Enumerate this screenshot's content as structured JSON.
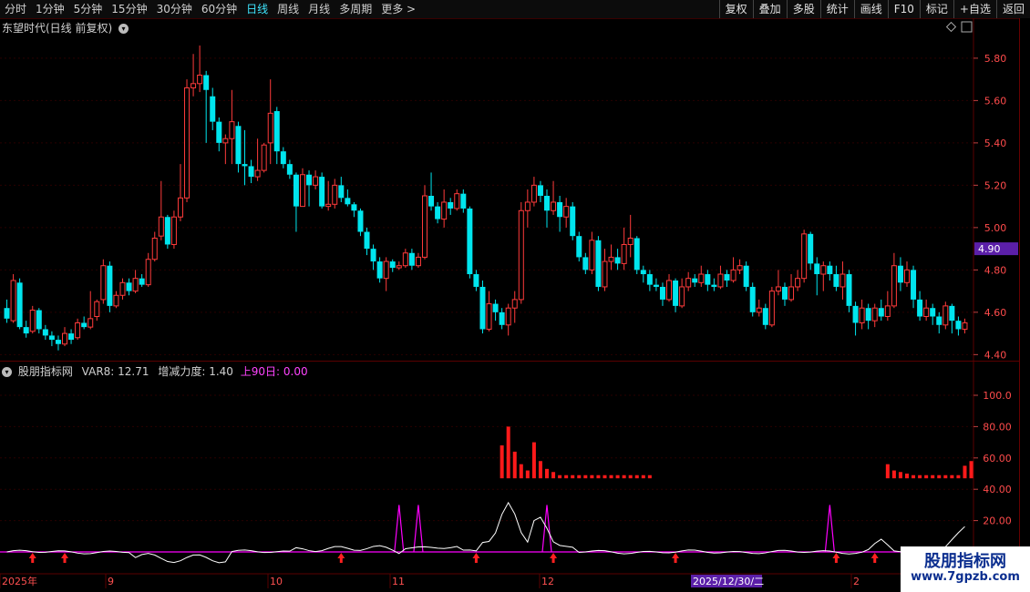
{
  "toolbar": {
    "periods": [
      "分时",
      "1分钟",
      "5分钟",
      "15分钟",
      "30分钟",
      "60分钟",
      "日线",
      "周线",
      "月线",
      "多周期",
      "更多 >"
    ],
    "active": "日线",
    "right_buttons": [
      "复权",
      "叠加",
      "多股",
      "统计",
      "画线",
      "F10",
      "标记",
      "+自选",
      "返回"
    ]
  },
  "stock": {
    "title": "东望时代(日线 前复权)",
    "current_price_tag": "4.90"
  },
  "price_axis": {
    "ticks": [
      "5.80",
      "5.60",
      "5.40",
      "5.20",
      "5.00",
      "4.80",
      "4.60",
      "4.40"
    ],
    "values": [
      5.8,
      5.6,
      5.4,
      5.2,
      5.0,
      4.8,
      4.6,
      4.4
    ]
  },
  "indicator": {
    "name": "股朋指标网",
    "var8": "VAR8: 12.71",
    "force": "增减力度: 1.40",
    "up90": "上90日: 0.00",
    "axis_ticks": [
      "100.0",
      "80.00",
      "60.00",
      "40.00",
      "20.00"
    ],
    "axis_values": [
      100,
      80,
      60,
      40,
      20
    ]
  },
  "time_axis": {
    "labels": [
      "2025年",
      "9",
      "10",
      "11",
      "12",
      "2",
      "2025/12/30/二"
    ]
  },
  "colors": {
    "up": "#ff3b3b",
    "down": "#00e5ee",
    "bg": "#000000",
    "grid": "#2a0000",
    "magenta": "#ff00ff",
    "tag_bg": "#5b1fa8"
  },
  "chart_data": {
    "type": "candlestick",
    "ylim": [
      4.38,
      5.92
    ],
    "candles": [
      [
        4.62,
        4.57,
        4.66,
        4.55
      ],
      [
        4.56,
        4.75,
        4.78,
        4.55
      ],
      [
        4.74,
        4.53,
        4.76,
        4.52
      ],
      [
        4.53,
        4.5,
        4.56,
        4.48
      ],
      [
        4.51,
        4.61,
        4.63,
        4.5
      ],
      [
        4.61,
        4.52,
        4.62,
        4.5
      ],
      [
        4.52,
        4.49,
        4.54,
        4.47
      ],
      [
        4.49,
        4.47,
        4.51,
        4.44
      ],
      [
        4.47,
        4.45,
        4.49,
        4.42
      ],
      [
        4.45,
        4.5,
        4.53,
        4.44
      ],
      [
        4.5,
        4.47,
        4.52,
        4.45
      ],
      [
        4.48,
        4.55,
        4.57,
        4.47
      ],
      [
        4.55,
        4.53,
        4.58,
        4.52
      ],
      [
        4.53,
        4.57,
        4.7,
        4.52
      ],
      [
        4.58,
        4.65,
        4.66,
        4.56
      ],
      [
        4.66,
        4.82,
        4.85,
        4.64
      ],
      [
        4.82,
        4.63,
        4.84,
        4.6
      ],
      [
        4.63,
        4.68,
        4.7,
        4.62
      ],
      [
        4.68,
        4.74,
        4.76,
        4.66
      ],
      [
        4.74,
        4.7,
        4.76,
        4.68
      ],
      [
        4.7,
        4.76,
        4.8,
        4.69
      ],
      [
        4.76,
        4.73,
        4.78,
        4.72
      ],
      [
        4.73,
        4.85,
        4.88,
        4.72
      ],
      [
        4.85,
        4.95,
        4.98,
        4.84
      ],
      [
        4.96,
        5.05,
        5.22,
        4.94
      ],
      [
        5.05,
        4.92,
        5.06,
        4.9
      ],
      [
        4.92,
        5.05,
        5.08,
        4.9
      ],
      [
        5.05,
        5.14,
        5.3,
        5.03
      ],
      [
        5.14,
        5.66,
        5.7,
        5.12
      ],
      [
        5.66,
        5.68,
        5.82,
        5.62
      ],
      [
        5.68,
        5.72,
        5.86,
        5.64
      ],
      [
        5.72,
        5.65,
        5.74,
        5.4
      ],
      [
        5.62,
        5.5,
        5.66,
        5.46
      ],
      [
        5.5,
        5.4,
        5.52,
        5.36
      ],
      [
        5.4,
        5.42,
        5.44,
        5.3
      ],
      [
        5.42,
        5.5,
        5.65,
        5.3
      ],
      [
        5.48,
        5.3,
        5.5,
        5.26
      ],
      [
        5.3,
        5.29,
        5.46,
        5.2
      ],
      [
        5.29,
        5.24,
        5.32,
        5.21
      ],
      [
        5.24,
        5.27,
        5.42,
        5.22
      ],
      [
        5.27,
        5.39,
        5.4,
        5.26
      ],
      [
        5.4,
        5.54,
        5.7,
        5.3
      ],
      [
        5.55,
        5.36,
        5.57,
        5.3
      ],
      [
        5.36,
        5.3,
        5.38,
        5.28
      ],
      [
        5.3,
        5.25,
        5.32,
        5.23
      ],
      [
        5.25,
        5.1,
        5.26,
        4.98
      ],
      [
        5.1,
        5.25,
        5.28,
        5.1
      ],
      [
        5.25,
        5.2,
        5.27,
        5.1
      ],
      [
        5.2,
        5.24,
        5.27,
        5.18
      ],
      [
        5.24,
        5.1,
        5.26,
        5.09
      ],
      [
        5.1,
        5.11,
        5.22,
        5.08
      ],
      [
        5.11,
        5.2,
        5.23,
        5.09
      ],
      [
        5.2,
        5.14,
        5.24,
        5.12
      ],
      [
        5.14,
        5.11,
        5.18,
        5.1
      ],
      [
        5.11,
        5.08,
        5.12,
        5.05
      ],
      [
        5.08,
        4.98,
        5.09,
        4.96
      ],
      [
        4.98,
        4.9,
        5.0,
        4.87
      ],
      [
        4.9,
        4.84,
        4.92,
        4.8
      ],
      [
        4.84,
        4.76,
        4.86,
        4.74
      ],
      [
        4.76,
        4.84,
        4.86,
        4.7
      ],
      [
        4.84,
        4.81,
        4.85,
        4.79
      ],
      [
        4.81,
        4.82,
        4.84,
        4.8
      ],
      [
        4.82,
        4.88,
        4.9,
        4.81
      ],
      [
        4.88,
        4.82,
        4.9,
        4.8
      ],
      [
        4.82,
        4.86,
        4.88,
        4.81
      ],
      [
        4.86,
        5.15,
        5.2,
        4.85
      ],
      [
        5.15,
        5.1,
        5.26,
        5.08
      ],
      [
        5.1,
        5.04,
        5.12,
        5.02
      ],
      [
        5.04,
        5.12,
        5.18,
        5.0
      ],
      [
        5.12,
        5.09,
        5.14,
        5.06
      ],
      [
        5.09,
        5.16,
        5.18,
        5.08
      ],
      [
        5.16,
        5.09,
        5.18,
        5.07
      ],
      [
        5.09,
        4.78,
        5.1,
        4.76
      ],
      [
        4.78,
        4.72,
        4.8,
        4.7
      ],
      [
        4.72,
        4.52,
        4.75,
        4.5
      ],
      [
        4.52,
        4.64,
        4.7,
        4.51
      ],
      [
        4.64,
        4.6,
        4.66,
        4.56
      ],
      [
        4.6,
        4.54,
        4.62,
        4.52
      ],
      [
        4.54,
        4.62,
        4.64,
        4.49
      ],
      [
        4.62,
        4.66,
        4.7,
        4.55
      ],
      [
        4.66,
        5.08,
        5.12,
        4.64
      ],
      [
        5.08,
        5.12,
        5.18,
        5.0
      ],
      [
        5.12,
        5.2,
        5.24,
        5.1
      ],
      [
        5.2,
        5.15,
        5.22,
        5.12
      ],
      [
        5.15,
        5.08,
        5.18,
        5.0
      ],
      [
        5.08,
        5.12,
        5.22,
        5.06
      ],
      [
        5.12,
        5.05,
        5.15,
        4.98
      ],
      [
        5.05,
        5.1,
        5.14,
        5.0
      ],
      [
        5.1,
        4.96,
        5.12,
        4.94
      ],
      [
        4.96,
        4.86,
        4.98,
        4.84
      ],
      [
        4.86,
        4.8,
        4.88,
        4.78
      ],
      [
        4.8,
        4.94,
        4.98,
        4.78
      ],
      [
        4.94,
        4.72,
        4.96,
        4.7
      ],
      [
        4.72,
        4.84,
        4.9,
        4.7
      ],
      [
        4.84,
        4.86,
        4.92,
        4.8
      ],
      [
        4.86,
        4.83,
        4.9,
        4.8
      ],
      [
        4.83,
        4.92,
        5.0,
        4.8
      ],
      [
        4.92,
        4.95,
        5.06,
        4.86
      ],
      [
        4.95,
        4.8,
        4.96,
        4.78
      ],
      [
        4.8,
        4.78,
        4.82,
        4.74
      ],
      [
        4.78,
        4.73,
        4.8,
        4.7
      ],
      [
        4.73,
        4.72,
        4.76,
        4.7
      ],
      [
        4.72,
        4.66,
        4.74,
        4.63
      ],
      [
        4.66,
        4.75,
        4.78,
        4.65
      ],
      [
        4.75,
        4.63,
        4.76,
        4.6
      ],
      [
        4.63,
        4.72,
        4.76,
        4.62
      ],
      [
        4.72,
        4.76,
        4.79,
        4.7
      ],
      [
        4.76,
        4.74,
        4.78,
        4.72
      ],
      [
        4.74,
        4.78,
        4.82,
        4.72
      ],
      [
        4.78,
        4.73,
        4.8,
        4.7
      ],
      [
        4.73,
        4.72,
        4.76,
        4.7
      ],
      [
        4.72,
        4.78,
        4.82,
        4.71
      ],
      [
        4.78,
        4.75,
        4.8,
        4.72
      ],
      [
        4.75,
        4.8,
        4.86,
        4.74
      ],
      [
        4.8,
        4.82,
        4.85,
        4.78
      ],
      [
        4.82,
        4.72,
        4.84,
        4.7
      ],
      [
        4.72,
        4.6,
        4.74,
        4.58
      ],
      [
        4.6,
        4.62,
        4.66,
        4.58
      ],
      [
        4.62,
        4.54,
        4.64,
        4.52
      ],
      [
        4.54,
        4.7,
        4.72,
        4.53
      ],
      [
        4.7,
        4.72,
        4.8,
        4.68
      ],
      [
        4.72,
        4.66,
        4.74,
        4.63
      ],
      [
        4.66,
        4.72,
        4.78,
        4.65
      ],
      [
        4.72,
        4.76,
        4.8,
        4.7
      ],
      [
        4.76,
        4.97,
        4.99,
        4.74
      ],
      [
        4.97,
        4.83,
        4.98,
        4.8
      ],
      [
        4.83,
        4.78,
        4.86,
        4.68
      ],
      [
        4.78,
        4.82,
        4.84,
        4.7
      ],
      [
        4.82,
        4.78,
        4.84,
        4.75
      ],
      [
        4.78,
        4.72,
        4.82,
        4.7
      ],
      [
        4.72,
        4.78,
        4.84,
        4.66
      ],
      [
        4.78,
        4.63,
        4.8,
        4.6
      ],
      [
        4.63,
        4.55,
        4.65,
        4.49
      ],
      [
        4.55,
        4.62,
        4.66,
        4.52
      ],
      [
        4.62,
        4.56,
        4.64,
        4.52
      ],
      [
        4.56,
        4.62,
        4.64,
        4.53
      ],
      [
        4.62,
        4.58,
        4.66,
        4.56
      ],
      [
        4.58,
        4.63,
        4.7,
        4.56
      ],
      [
        4.63,
        4.82,
        4.88,
        4.62
      ],
      [
        4.82,
        4.74,
        4.86,
        4.7
      ],
      [
        4.74,
        4.8,
        4.84,
        4.72
      ],
      [
        4.8,
        4.66,
        4.82,
        4.62
      ],
      [
        4.66,
        4.58,
        4.7,
        4.56
      ],
      [
        4.58,
        4.62,
        4.66,
        4.56
      ],
      [
        4.62,
        4.58,
        4.64,
        4.54
      ],
      [
        4.58,
        4.54,
        4.6,
        4.5
      ],
      [
        4.54,
        4.63,
        4.65,
        4.52
      ],
      [
        4.63,
        4.56,
        4.64,
        4.5
      ],
      [
        4.56,
        4.52,
        4.58,
        4.49
      ],
      [
        4.52,
        4.55,
        4.57,
        4.5
      ]
    ],
    "indicator_bars": [
      {
        "i": 77,
        "v": 68
      },
      {
        "i": 78,
        "v": 80
      },
      {
        "i": 79,
        "v": 64
      },
      {
        "i": 80,
        "v": 56
      },
      {
        "i": 81,
        "v": 52
      },
      {
        "i": 82,
        "v": 70
      },
      {
        "i": 83,
        "v": 58
      },
      {
        "i": 84,
        "v": 53
      },
      {
        "i": 85,
        "v": 51
      },
      {
        "i": 86,
        "v": 49
      },
      {
        "i": 87,
        "v": 49
      },
      {
        "i": 88,
        "v": 49
      },
      {
        "i": 89,
        "v": 49
      },
      {
        "i": 90,
        "v": 49
      },
      {
        "i": 91,
        "v": 49
      },
      {
        "i": 92,
        "v": 49
      },
      {
        "i": 93,
        "v": 49
      },
      {
        "i": 94,
        "v": 49
      },
      {
        "i": 95,
        "v": 49
      },
      {
        "i": 96,
        "v": 49
      },
      {
        "i": 97,
        "v": 49
      },
      {
        "i": 98,
        "v": 49
      },
      {
        "i": 99,
        "v": 49
      },
      {
        "i": 100,
        "v": 49
      },
      {
        "i": 137,
        "v": 56
      },
      {
        "i": 138,
        "v": 52
      },
      {
        "i": 139,
        "v": 51
      },
      {
        "i": 140,
        "v": 50
      },
      {
        "i": 141,
        "v": 49
      },
      {
        "i": 142,
        "v": 49
      },
      {
        "i": 143,
        "v": 49
      },
      {
        "i": 144,
        "v": 49
      },
      {
        "i": 145,
        "v": 49
      },
      {
        "i": 146,
        "v": 49
      },
      {
        "i": 147,
        "v": 49
      },
      {
        "i": 148,
        "v": 49
      },
      {
        "i": 149,
        "v": 55
      },
      {
        "i": 150,
        "v": 58
      }
    ],
    "magenta_peaks": [
      61,
      64,
      84,
      128
    ],
    "arrow_positions": [
      4,
      9,
      52,
      73,
      85,
      104,
      129,
      135,
      144
    ]
  }
}
